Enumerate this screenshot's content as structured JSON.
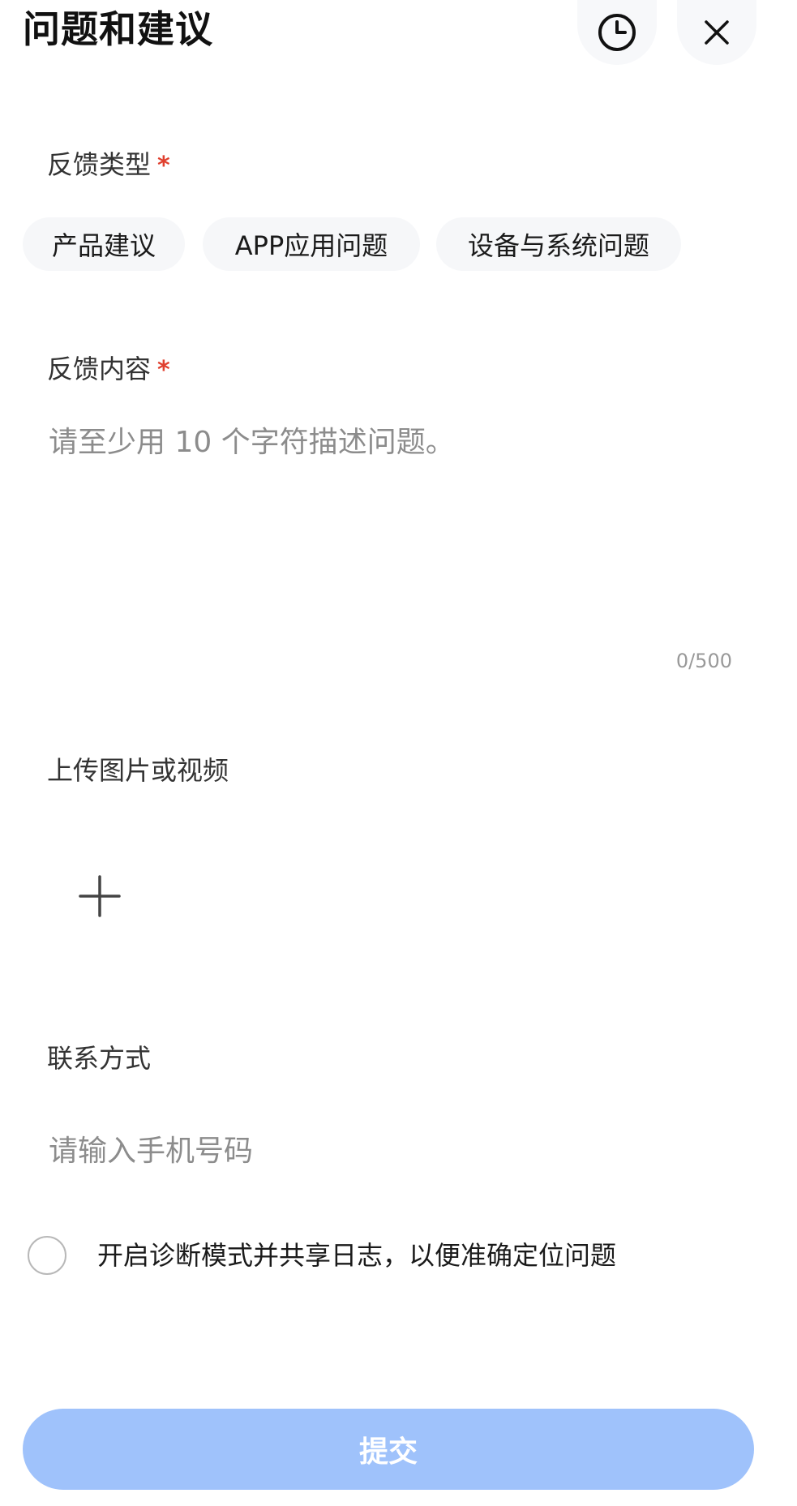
{
  "header": {
    "title": "问题和建议",
    "history_icon": "clock-icon",
    "close_icon": "close-icon"
  },
  "feedback_type": {
    "label": "反馈类型",
    "required_mark": "*",
    "options": [
      "产品建议",
      "APP应用问题",
      "设备与系统问题"
    ]
  },
  "feedback_content": {
    "label": "反馈内容",
    "required_mark": "*",
    "placeholder": "请至少用 10 个字符描述问题。",
    "value": "",
    "counter": "0/500"
  },
  "upload": {
    "label": "上传图片或视频",
    "add_icon": "plus-icon"
  },
  "contact": {
    "label": "联系方式",
    "placeholder": "请输入手机号码",
    "value": ""
  },
  "diagnostic": {
    "label": "开启诊断模式并共享日志，以便准确定位问题",
    "checked": false
  },
  "submit": {
    "label": "提交"
  },
  "colors": {
    "accent_disabled": "#9fc2fb",
    "required": "#e0402f",
    "chip_bg": "#f6f7f9"
  }
}
